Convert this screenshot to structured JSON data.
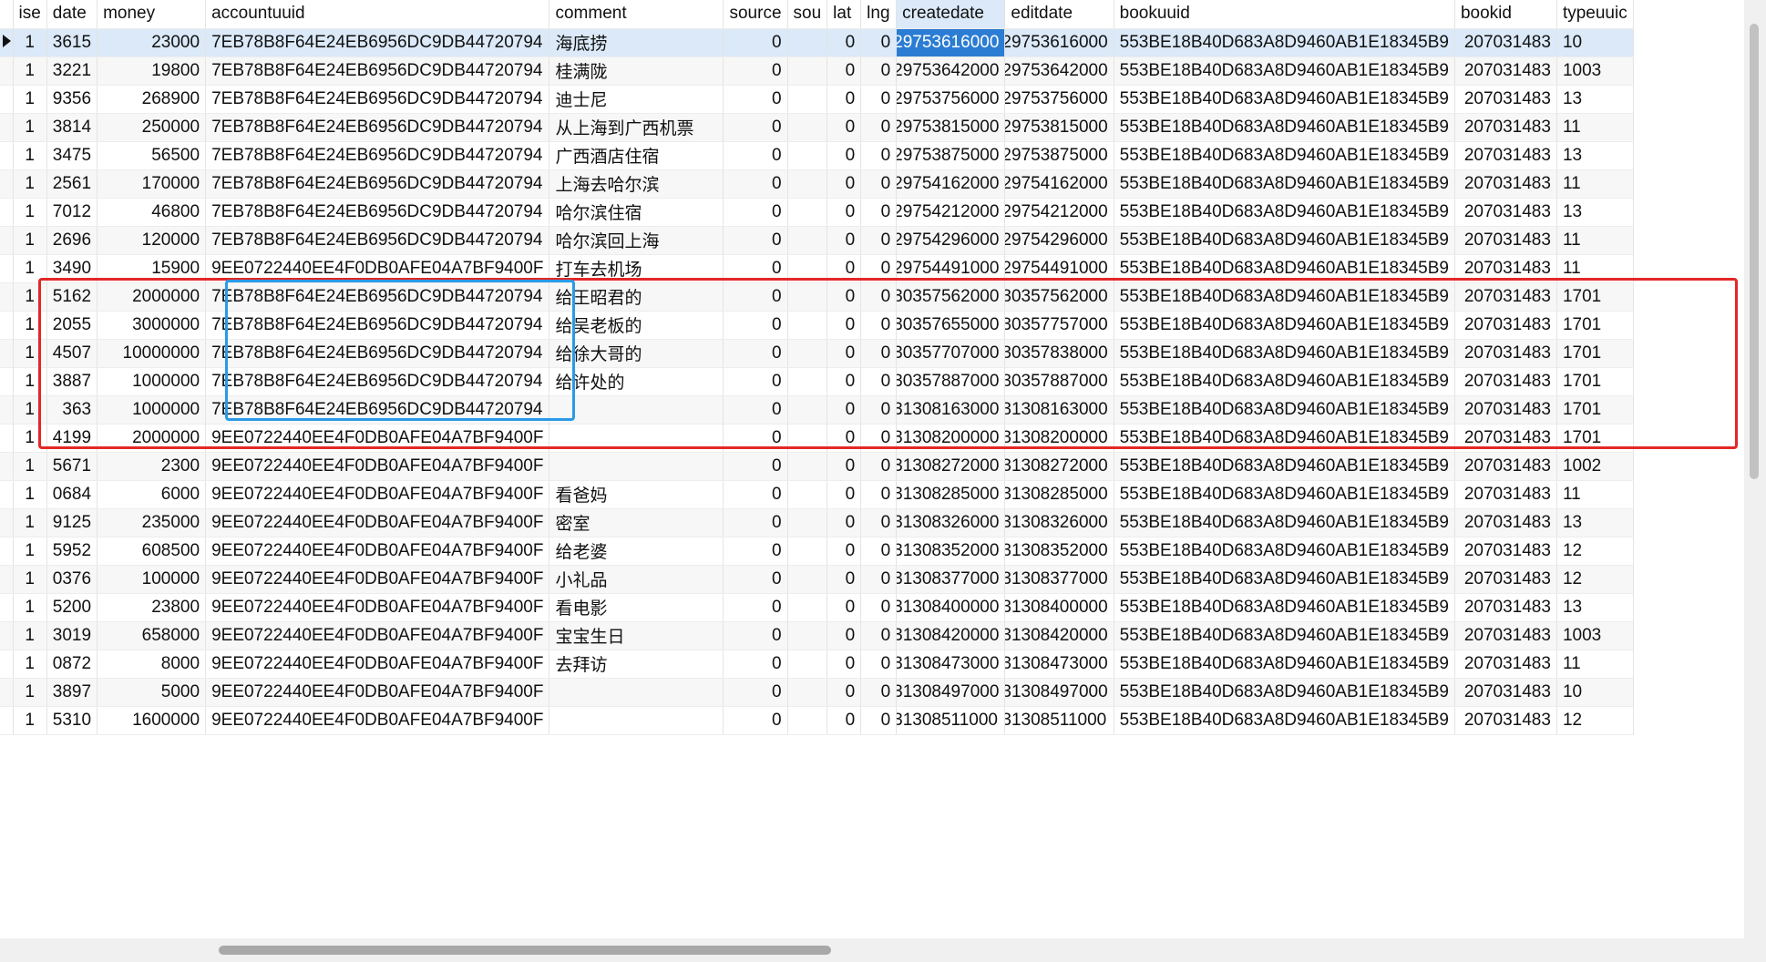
{
  "columns": [
    "ise",
    "date",
    "money",
    "accountuuid",
    "comment",
    "source",
    "sou",
    "lat",
    "lng",
    "createdate",
    "editdate",
    "bookuuid",
    "bookid",
    "typeuuic"
  ],
  "selected_column": "createdate",
  "rows": [
    {
      "ise": "1",
      "date": "3615",
      "money": "23000",
      "accountuuid": "7EB78B8F64E24EB6956DC9DB44720794",
      "comment": "海底捞",
      "source": "0",
      "sou": "",
      "lat": "0",
      "lng": "0",
      "createdate": "29753616000",
      "editdate": "29753616000",
      "bookuuid": "553BE18B40D683A8D9460AB1E18345B9",
      "bookid": "207031483",
      "typeuuic": "10"
    },
    {
      "ise": "1",
      "date": "3221",
      "money": "19800",
      "accountuuid": "7EB78B8F64E24EB6956DC9DB44720794",
      "comment": "桂满陇",
      "source": "0",
      "sou": "",
      "lat": "0",
      "lng": "0",
      "createdate": "29753642000",
      "editdate": "29753642000",
      "bookuuid": "553BE18B40D683A8D9460AB1E18345B9",
      "bookid": "207031483",
      "typeuuic": "1003"
    },
    {
      "ise": "1",
      "date": "9356",
      "money": "268900",
      "accountuuid": "7EB78B8F64E24EB6956DC9DB44720794",
      "comment": "迪士尼",
      "source": "0",
      "sou": "",
      "lat": "0",
      "lng": "0",
      "createdate": "29753756000",
      "editdate": "29753756000",
      "bookuuid": "553BE18B40D683A8D9460AB1E18345B9",
      "bookid": "207031483",
      "typeuuic": "13"
    },
    {
      "ise": "1",
      "date": "3814",
      "money": "250000",
      "accountuuid": "7EB78B8F64E24EB6956DC9DB44720794",
      "comment": "从上海到广西机票",
      "source": "0",
      "sou": "",
      "lat": "0",
      "lng": "0",
      "createdate": "29753815000",
      "editdate": "29753815000",
      "bookuuid": "553BE18B40D683A8D9460AB1E18345B9",
      "bookid": "207031483",
      "typeuuic": "11"
    },
    {
      "ise": "1",
      "date": "3475",
      "money": "56500",
      "accountuuid": "7EB78B8F64E24EB6956DC9DB44720794",
      "comment": "广西酒店住宿",
      "source": "0",
      "sou": "",
      "lat": "0",
      "lng": "0",
      "createdate": "29753875000",
      "editdate": "29753875000",
      "bookuuid": "553BE18B40D683A8D9460AB1E18345B9",
      "bookid": "207031483",
      "typeuuic": "13"
    },
    {
      "ise": "1",
      "date": "2561",
      "money": "170000",
      "accountuuid": "7EB78B8F64E24EB6956DC9DB44720794",
      "comment": "上海去哈尔滨",
      "source": "0",
      "sou": "",
      "lat": "0",
      "lng": "0",
      "createdate": "29754162000",
      "editdate": "29754162000",
      "bookuuid": "553BE18B40D683A8D9460AB1E18345B9",
      "bookid": "207031483",
      "typeuuic": "11"
    },
    {
      "ise": "1",
      "date": "7012",
      "money": "46800",
      "accountuuid": "7EB78B8F64E24EB6956DC9DB44720794",
      "comment": "哈尔滨住宿",
      "source": "0",
      "sou": "",
      "lat": "0",
      "lng": "0",
      "createdate": "29754212000",
      "editdate": "29754212000",
      "bookuuid": "553BE18B40D683A8D9460AB1E18345B9",
      "bookid": "207031483",
      "typeuuic": "13"
    },
    {
      "ise": "1",
      "date": "2696",
      "money": "120000",
      "accountuuid": "7EB78B8F64E24EB6956DC9DB44720794",
      "comment": "哈尔滨回上海",
      "source": "0",
      "sou": "",
      "lat": "0",
      "lng": "0",
      "createdate": "29754296000",
      "editdate": "29754296000",
      "bookuuid": "553BE18B40D683A8D9460AB1E18345B9",
      "bookid": "207031483",
      "typeuuic": "11"
    },
    {
      "ise": "1",
      "date": "3490",
      "money": "15900",
      "accountuuid": "9EE0722440EE4F0DB0AFE04A7BF9400F",
      "comment": "打车去机场",
      "source": "0",
      "sou": "",
      "lat": "0",
      "lng": "0",
      "createdate": "29754491000",
      "editdate": "29754491000",
      "bookuuid": "553BE18B40D683A8D9460AB1E18345B9",
      "bookid": "207031483",
      "typeuuic": "11"
    },
    {
      "ise": "1",
      "date": "5162",
      "money": "2000000",
      "accountuuid": "7EB78B8F64E24EB6956DC9DB44720794",
      "comment": "给王昭君的",
      "source": "0",
      "sou": "",
      "lat": "0",
      "lng": "0",
      "createdate": "30357562000",
      "editdate": "30357562000",
      "bookuuid": "553BE18B40D683A8D9460AB1E18345B9",
      "bookid": "207031483",
      "typeuuic": "1701"
    },
    {
      "ise": "1",
      "date": "2055",
      "money": "3000000",
      "accountuuid": "7EB78B8F64E24EB6956DC9DB44720794",
      "comment": "给吴老板的",
      "source": "0",
      "sou": "",
      "lat": "0",
      "lng": "0",
      "createdate": "30357655000",
      "editdate": "30357757000",
      "bookuuid": "553BE18B40D683A8D9460AB1E18345B9",
      "bookid": "207031483",
      "typeuuic": "1701"
    },
    {
      "ise": "1",
      "date": "4507",
      "money": "10000000",
      "accountuuid": "7EB78B8F64E24EB6956DC9DB44720794",
      "comment": "给徐大哥的",
      "source": "0",
      "sou": "",
      "lat": "0",
      "lng": "0",
      "createdate": "30357707000",
      "editdate": "30357838000",
      "bookuuid": "553BE18B40D683A8D9460AB1E18345B9",
      "bookid": "207031483",
      "typeuuic": "1701"
    },
    {
      "ise": "1",
      "date": "3887",
      "money": "1000000",
      "accountuuid": "7EB78B8F64E24EB6956DC9DB44720794",
      "comment": "给许处的",
      "source": "0",
      "sou": "",
      "lat": "0",
      "lng": "0",
      "createdate": "30357887000",
      "editdate": "30357887000",
      "bookuuid": "553BE18B40D683A8D9460AB1E18345B9",
      "bookid": "207031483",
      "typeuuic": "1701"
    },
    {
      "ise": "1",
      "date": "363",
      "money": "1000000",
      "accountuuid": "7EB78B8F64E24EB6956DC9DB44720794",
      "comment": "",
      "source": "0",
      "sou": "",
      "lat": "0",
      "lng": "0",
      "createdate": "31308163000",
      "editdate": "31308163000",
      "bookuuid": "553BE18B40D683A8D9460AB1E18345B9",
      "bookid": "207031483",
      "typeuuic": "1701"
    },
    {
      "ise": "1",
      "date": "4199",
      "money": "2000000",
      "accountuuid": "9EE0722440EE4F0DB0AFE04A7BF9400F",
      "comment": "",
      "source": "0",
      "sou": "",
      "lat": "0",
      "lng": "0",
      "createdate": "31308200000",
      "editdate": "31308200000",
      "bookuuid": "553BE18B40D683A8D9460AB1E18345B9",
      "bookid": "207031483",
      "typeuuic": "1701"
    },
    {
      "ise": "1",
      "date": "5671",
      "money": "2300",
      "accountuuid": "9EE0722440EE4F0DB0AFE04A7BF9400F",
      "comment": "",
      "source": "0",
      "sou": "",
      "lat": "0",
      "lng": "0",
      "createdate": "31308272000",
      "editdate": "31308272000",
      "bookuuid": "553BE18B40D683A8D9460AB1E18345B9",
      "bookid": "207031483",
      "typeuuic": "1002"
    },
    {
      "ise": "1",
      "date": "0684",
      "money": "6000",
      "accountuuid": "9EE0722440EE4F0DB0AFE04A7BF9400F",
      "comment": "看爸妈",
      "source": "0",
      "sou": "",
      "lat": "0",
      "lng": "0",
      "createdate": "31308285000",
      "editdate": "31308285000",
      "bookuuid": "553BE18B40D683A8D9460AB1E18345B9",
      "bookid": "207031483",
      "typeuuic": "11"
    },
    {
      "ise": "1",
      "date": "9125",
      "money": "235000",
      "accountuuid": "9EE0722440EE4F0DB0AFE04A7BF9400F",
      "comment": "密室",
      "source": "0",
      "sou": "",
      "lat": "0",
      "lng": "0",
      "createdate": "31308326000",
      "editdate": "31308326000",
      "bookuuid": "553BE18B40D683A8D9460AB1E18345B9",
      "bookid": "207031483",
      "typeuuic": "13"
    },
    {
      "ise": "1",
      "date": "5952",
      "money": "608500",
      "accountuuid": "9EE0722440EE4F0DB0AFE04A7BF9400F",
      "comment": "给老婆",
      "source": "0",
      "sou": "",
      "lat": "0",
      "lng": "0",
      "createdate": "31308352000",
      "editdate": "31308352000",
      "bookuuid": "553BE18B40D683A8D9460AB1E18345B9",
      "bookid": "207031483",
      "typeuuic": "12"
    },
    {
      "ise": "1",
      "date": "0376",
      "money": "100000",
      "accountuuid": "9EE0722440EE4F0DB0AFE04A7BF9400F",
      "comment": "小礼品",
      "source": "0",
      "sou": "",
      "lat": "0",
      "lng": "0",
      "createdate": "31308377000",
      "editdate": "31308377000",
      "bookuuid": "553BE18B40D683A8D9460AB1E18345B9",
      "bookid": "207031483",
      "typeuuic": "12"
    },
    {
      "ise": "1",
      "date": "5200",
      "money": "23800",
      "accountuuid": "9EE0722440EE4F0DB0AFE04A7BF9400F",
      "comment": "看电影",
      "source": "0",
      "sou": "",
      "lat": "0",
      "lng": "0",
      "createdate": "31308400000",
      "editdate": "31308400000",
      "bookuuid": "553BE18B40D683A8D9460AB1E18345B9",
      "bookid": "207031483",
      "typeuuic": "13"
    },
    {
      "ise": "1",
      "date": "3019",
      "money": "658000",
      "accountuuid": "9EE0722440EE4F0DB0AFE04A7BF9400F",
      "comment": "宝宝生日",
      "source": "0",
      "sou": "",
      "lat": "0",
      "lng": "0",
      "createdate": "31308420000",
      "editdate": "31308420000",
      "bookuuid": "553BE18B40D683A8D9460AB1E18345B9",
      "bookid": "207031483",
      "typeuuic": "1003"
    },
    {
      "ise": "1",
      "date": "0872",
      "money": "8000",
      "accountuuid": "9EE0722440EE4F0DB0AFE04A7BF9400F",
      "comment": "去拜访",
      "source": "0",
      "sou": "",
      "lat": "0",
      "lng": "0",
      "createdate": "31308473000",
      "editdate": "31308473000",
      "bookuuid": "553BE18B40D683A8D9460AB1E18345B9",
      "bookid": "207031483",
      "typeuuic": "11"
    },
    {
      "ise": "1",
      "date": "3897",
      "money": "5000",
      "accountuuid": "9EE0722440EE4F0DB0AFE04A7BF9400F",
      "comment": "",
      "source": "0",
      "sou": "",
      "lat": "0",
      "lng": "0",
      "createdate": "31308497000",
      "editdate": "31308497000",
      "bookuuid": "553BE18B40D683A8D9460AB1E18345B9",
      "bookid": "207031483",
      "typeuuic": "10"
    },
    {
      "ise": "1",
      "date": "5310",
      "money": "1600000",
      "accountuuid": "9EE0722440EE4F0DB0AFE04A7BF9400F",
      "comment": "",
      "source": "0",
      "sou": "",
      "lat": "0",
      "lng": "0",
      "createdate": "31308511000",
      "editdate": "31308511000",
      "bookuuid": "553BE18B40D683A8D9460AB1E18345B9",
      "bookid": "207031483",
      "typeuuic": "12"
    }
  ],
  "colors": {
    "selection_row": "#dbe9f8",
    "selected_cell": "#2b7cd3",
    "highlight_red": "#e32727",
    "highlight_blue": "#2a9ae6"
  },
  "icons": {
    "current_row": "row-pointer-icon"
  }
}
